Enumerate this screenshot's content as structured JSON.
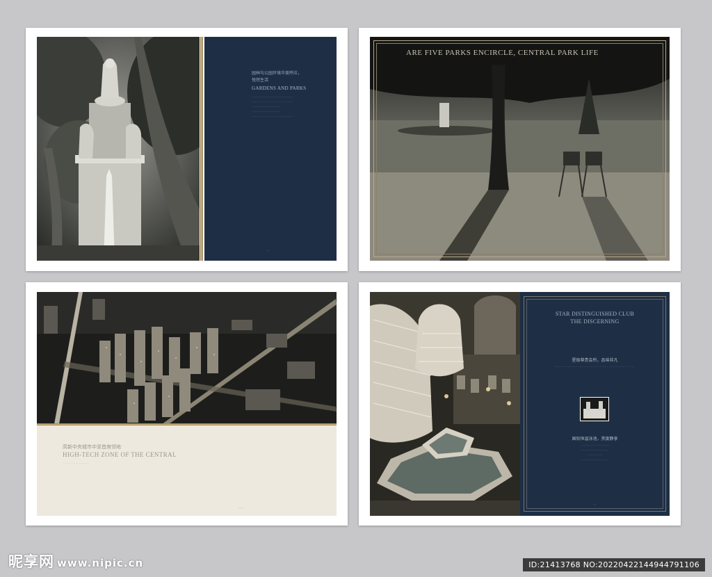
{
  "panel1": {
    "cn_title_line1": "园林与公园环境华美呼应，",
    "cn_title_line2": "悦然生活",
    "en_title": "GARDENS AND PARKS",
    "body_lines": [
      "······································",
      "······································",
      "··························",
      "··························",
      "······································"
    ],
    "page_no": "—"
  },
  "panel2": {
    "headline": "ARE FIVE PARKS ENCIRCLE, CENTRAL PARK LIFE"
  },
  "panel3": {
    "cn_title": "高新中央城市中坚首席领地",
    "en_title": "HIGH-TECH ZONE OF THE CENTRAL",
    "sub_line": "·········  ·········  ·········",
    "page_no": "——"
  },
  "panel4": {
    "en_title_line1": "STAR DISTINGUISHED CLUB",
    "en_title_line2": "THE DISCERNING",
    "cn_heading1": "星级尊贵会所，品味非凡",
    "body_line1": "·······································································",
    "cn_heading2": "国际恒温泳池，赏度静享",
    "body_lines2": [
      "··························",
      "··························",
      "··············",
      "··························"
    ],
    "page_no": "—"
  },
  "watermark": {
    "logo_text": "昵享网",
    "url": "www.nipic.cn",
    "id_text": "ID:21413768 NO:20220422144944791106"
  }
}
